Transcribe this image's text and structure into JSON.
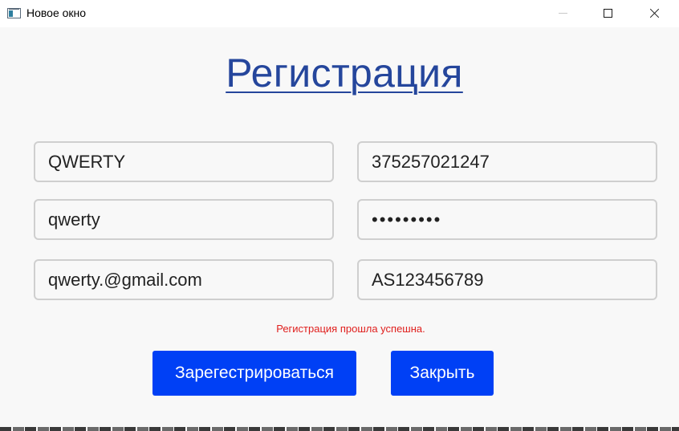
{
  "window": {
    "title": "Новое окно",
    "controls": {
      "minimize": "minimize",
      "maximize": "maximize",
      "close": "close"
    }
  },
  "form": {
    "heading": "Регистрация",
    "fields": {
      "login": "QWERTY",
      "phone": "375257021247",
      "name": "qwerty",
      "password": "qwertyuio",
      "email": "qwerty.@gmail.com",
      "passport": "AS123456789"
    },
    "status_message": "Регистрация прошла успешна.",
    "register_button": "Зарегестрироваться",
    "close_button": "Закрыть"
  },
  "colors": {
    "heading": "#25469c",
    "button": "#0040f5",
    "status": "#e0201e"
  }
}
